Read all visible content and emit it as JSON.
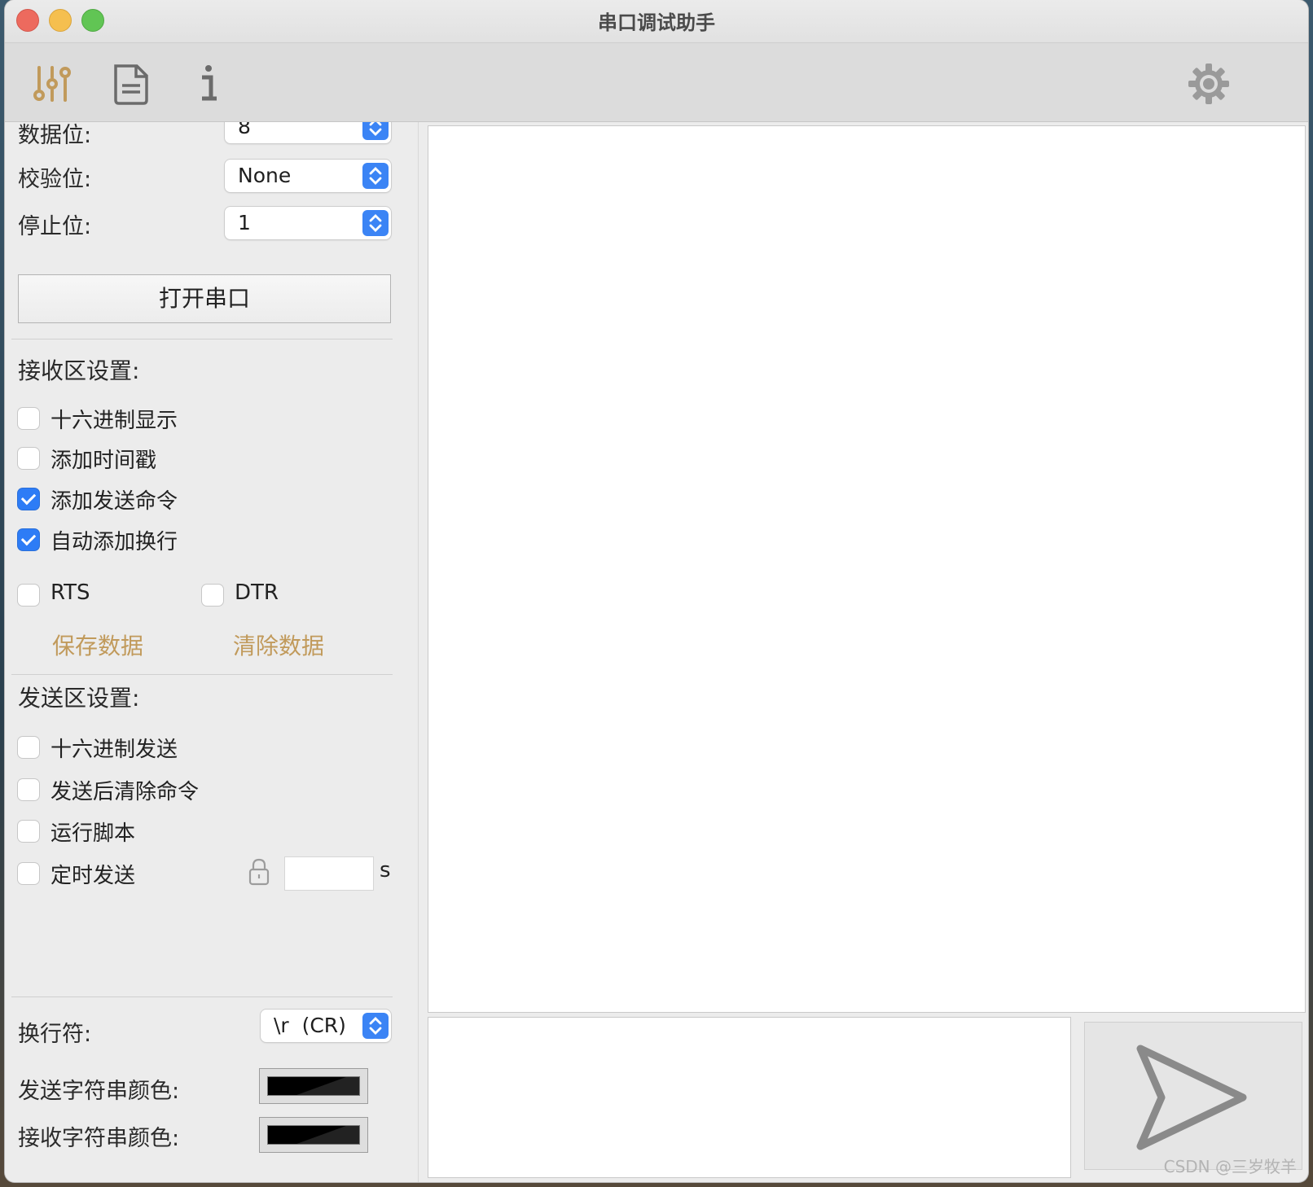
{
  "window": {
    "title": "串口调试助手"
  },
  "toolbar": {
    "icons": [
      "sliders-icon",
      "document-icon",
      "info-icon",
      "gear-icon"
    ],
    "accent_color": "#c19a5b"
  },
  "serial": {
    "data_bits": {
      "label": "数据位:",
      "value": "8"
    },
    "parity": {
      "label": "校验位:",
      "value": "None"
    },
    "stop_bits": {
      "label": "停止位:",
      "value": "1"
    },
    "open_button": "打开串口"
  },
  "receive": {
    "heading": "接收区设置:",
    "options": [
      {
        "label": "十六进制显示",
        "checked": false
      },
      {
        "label": "添加时间戳",
        "checked": false
      },
      {
        "label": "添加发送命令",
        "checked": true
      },
      {
        "label": "自动添加换行",
        "checked": true
      }
    ],
    "rts": {
      "label": "RTS",
      "checked": false
    },
    "dtr": {
      "label": "DTR",
      "checked": false
    },
    "save_link": "保存数据",
    "clear_link": "清除数据"
  },
  "send": {
    "heading": "发送区设置:",
    "options": [
      {
        "label": "十六进制发送",
        "checked": false
      },
      {
        "label": "发送后清除命令",
        "checked": false
      },
      {
        "label": "运行脚本",
        "checked": false
      },
      {
        "label": "定时发送",
        "checked": false
      }
    ],
    "interval_value": "",
    "interval_unit": "s"
  },
  "format": {
    "newline_label": "换行符:",
    "newline_value": "\\r  (CR)",
    "send_color_label": "发送字符串颜色:",
    "send_color": "#000000",
    "recv_color_label": "接收字符串颜色:",
    "recv_color": "#000000"
  },
  "watermark": "CSDN @三岁牧羊"
}
